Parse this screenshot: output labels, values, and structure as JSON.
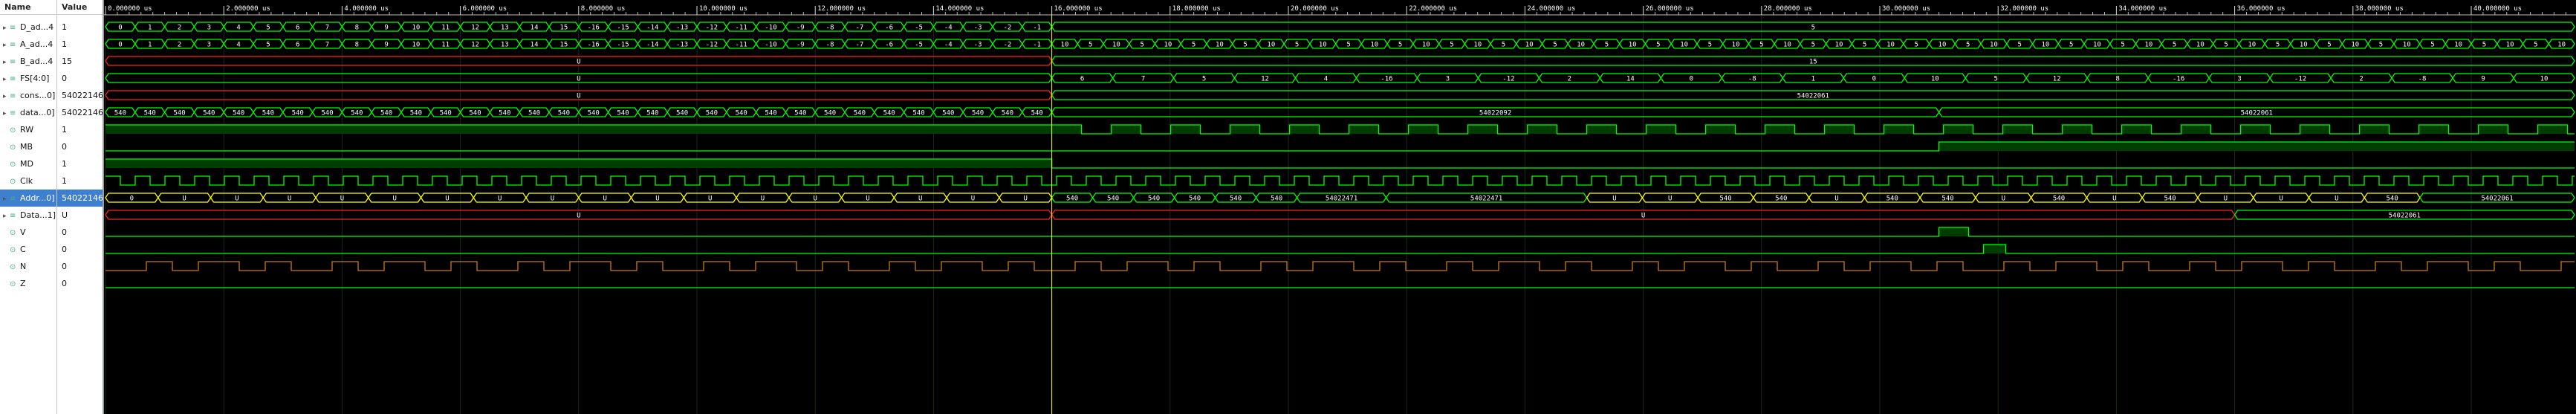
{
  "panel": {
    "name_header": "Name",
    "value_header": "Value"
  },
  "signals": [
    {
      "name": "D_ad...4",
      "value": "1",
      "kind": "bus",
      "expandable": true
    },
    {
      "name": "A_ad...4",
      "value": "1",
      "kind": "bus",
      "expandable": true
    },
    {
      "name": "B_ad...4",
      "value": "15",
      "kind": "bus",
      "expandable": true
    },
    {
      "name": "FS[4:0]",
      "value": "0",
      "kind": "bus",
      "expandable": true
    },
    {
      "name": "cons...0]",
      "value": "54022146",
      "kind": "bus",
      "expandable": true
    },
    {
      "name": "data...0]",
      "value": "54022146",
      "kind": "bus",
      "expandable": true
    },
    {
      "name": "RW",
      "value": "1",
      "kind": "bit",
      "expandable": false
    },
    {
      "name": "MB",
      "value": "0",
      "kind": "bit",
      "expandable": false
    },
    {
      "name": "MD",
      "value": "1",
      "kind": "bit",
      "expandable": false
    },
    {
      "name": "Clk",
      "value": "1",
      "kind": "bit",
      "expandable": false
    },
    {
      "name": "Addr...0]",
      "value": "54022146",
      "kind": "bus",
      "expandable": true,
      "selected": true
    },
    {
      "name": "Data...1]",
      "value": "U",
      "kind": "bus",
      "expandable": true
    },
    {
      "name": "V",
      "value": "0",
      "kind": "bit",
      "expandable": false
    },
    {
      "name": "C",
      "value": "0",
      "kind": "bit",
      "expandable": false
    },
    {
      "name": "N",
      "value": "0",
      "kind": "bit",
      "expandable": false
    },
    {
      "name": "Z",
      "value": "0",
      "kind": "bit",
      "expandable": false
    }
  ],
  "timeline": {
    "ticks": [
      "0.000000 us",
      "2.000000 us",
      "4.000000 us",
      "6.000000 us",
      "8.000000 us",
      "10.000000 us",
      "12.000000 us",
      "14.000000 us",
      "16.000000 us",
      "18.000000 us",
      "20.000000 us",
      "22.000000 us",
      "24.000000 us",
      "26.000000 us",
      "28.000000 us",
      "30.000000 us",
      "32.000000 us",
      "34.000000 us",
      "36.000000 us",
      "38.000000 us",
      "40.000000 us"
    ]
  },
  "waves": {
    "d_addr_first": [
      "0",
      "1",
      "2",
      "3",
      "4",
      "5",
      "6",
      "7",
      "8",
      "9",
      "10",
      "11",
      "12",
      "13",
      "14",
      "15",
      "-16",
      "-15",
      "-14",
      "-13",
      "-12",
      "-11",
      "-10",
      "-9",
      "-8",
      "-7",
      "-6",
      "-5",
      "-4",
      "-3",
      "-2",
      "-1"
    ],
    "d_addr_second_label": "5",
    "a_addr_first": [
      "0",
      "1",
      "2",
      "3",
      "4",
      "5",
      "6",
      "7",
      "8",
      "9",
      "10",
      "11",
      "12",
      "13",
      "14",
      "15",
      "-16",
      "-15",
      "-14",
      "-13",
      "-12",
      "-11",
      "-10",
      "-9",
      "-8",
      "-7",
      "-6",
      "-5",
      "-4",
      "-3",
      "-2",
      "-1"
    ],
    "a_addr_second": [
      "10",
      "5",
      "10",
      "5",
      "10",
      "5",
      "10",
      "5",
      "10",
      "5",
      "10",
      "5",
      "10",
      "5",
      "10",
      "5",
      "10",
      "5",
      "10",
      "5",
      "10",
      "5",
      "10",
      "5",
      "10",
      "5",
      "10",
      "5",
      "10",
      "5",
      "10",
      "5",
      "10",
      "5",
      "10",
      "5",
      "10",
      "5",
      "10",
      "5",
      "10",
      "5",
      "10",
      "5",
      "10",
      "5",
      "10",
      "5",
      "10",
      "5",
      "10",
      "5",
      "10",
      "5",
      "10",
      "5",
      "10",
      "5",
      "10"
    ],
    "b_addr_first": "U",
    "b_addr_second": "15",
    "fs_first": "U",
    "fs_second": [
      "6",
      "7",
      "5",
      "12",
      "4",
      "-16",
      "3",
      "-12",
      "2",
      "14",
      "0",
      "-8",
      "1",
      "0",
      "10",
      "5",
      "12",
      "8",
      "-16",
      "3",
      "-12",
      "2",
      "-8",
      "9",
      "10"
    ],
    "cons_first": "U",
    "cons_second": "54022061",
    "data_first_cell": "540",
    "data_mid": "54022092",
    "data_end": "54022061",
    "addr_labels": [
      "0",
      "U",
      "U",
      "U",
      "U",
      "U",
      "U",
      "U",
      "U",
      "U",
      "U",
      "U",
      "U",
      "U",
      "U",
      "U",
      "U",
      "U"
    ],
    "addr_mid": "54022471",
    "addr_mid2": "54022471",
    "addr_end": "54022061",
    "data_bus_first": "U",
    "data_bus_second": "U",
    "data_bus_end": "54022061"
  },
  "colors": {
    "bg": "#000000",
    "wave": "#00ff00",
    "bus_text": "#ffffff",
    "undef": "#ff2020",
    "cursor": "#ffff00",
    "fill_bit": "#003d00",
    "orange": "#c97a1c"
  }
}
